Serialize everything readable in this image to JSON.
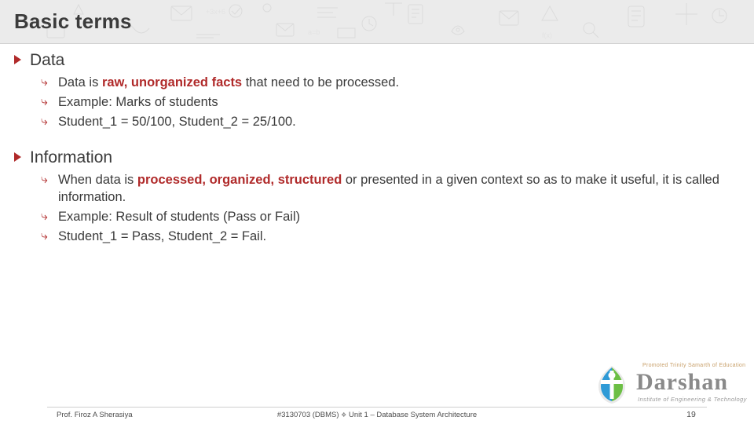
{
  "header": {
    "title": "Basic terms"
  },
  "content": {
    "sections": [
      {
        "heading": "Data",
        "bullets": [
          {
            "prefix": "Data is ",
            "highlight": "raw, unorganized facts",
            "suffix": " that need to be processed."
          },
          {
            "prefix": "Example: Marks of students",
            "highlight": "",
            "suffix": ""
          },
          {
            "prefix": "Student_1 = 50/100, Student_2 = 25/100.",
            "highlight": "",
            "suffix": ""
          }
        ]
      },
      {
        "heading": "Information",
        "bullets": [
          {
            "prefix": "When data is ",
            "highlight": "processed, organized, structured",
            "suffix": " or presented in a given context so as to make it useful, it is called information."
          },
          {
            "prefix": "Example: Result of students (Pass or Fail)",
            "highlight": "",
            "suffix": ""
          },
          {
            "prefix": "Student_1 = Pass, Student_2 = Fail.",
            "highlight": "",
            "suffix": ""
          }
        ]
      }
    ]
  },
  "logo": {
    "tagline_top": "Promoted Trinity Samarth of Education",
    "word": "Darshan",
    "tagline_bottom": "Institute of Engineering & Technology"
  },
  "footer": {
    "author": "Prof. Firoz A Sherasiya",
    "course": "#3130703 (DBMS)",
    "separator": "❖",
    "unit": "Unit 1 – Database System Architecture",
    "page": "19"
  },
  "colors": {
    "accent": "#b02a2a",
    "header_bg": "#ebebeb",
    "text": "#3a3a3a"
  }
}
